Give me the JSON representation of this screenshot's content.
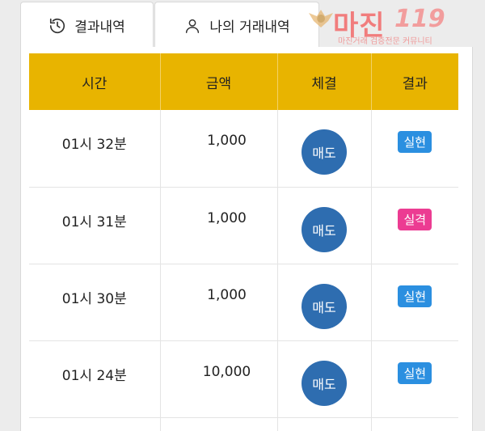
{
  "tabs": [
    {
      "label": "결과내역",
      "icon": "history-icon"
    },
    {
      "label": "나의 거래내역",
      "icon": "user-icon"
    }
  ],
  "watermark": {
    "title": "마진",
    "number": "119",
    "subtitle": "마진거래 검증전문 커뮤니티"
  },
  "table": {
    "headers": [
      "시간",
      "금액",
      "체결",
      "결과"
    ],
    "rows": [
      {
        "time": "01시 32분",
        "amount": "1,000",
        "exec": "매도",
        "result": "실현",
        "result_color": "#2b8fe0"
      },
      {
        "time": "01시 31분",
        "amount": "1,000",
        "exec": "매도",
        "result": "실격",
        "result_color": "#ec3c92"
      },
      {
        "time": "01시 30분",
        "amount": "1,000",
        "exec": "매도",
        "result": "실현",
        "result_color": "#2b8fe0"
      },
      {
        "time": "01시 24분",
        "amount": "10,000",
        "exec": "매도",
        "result": "실현",
        "result_color": "#2b8fe0"
      }
    ]
  },
  "colors": {
    "header_bg": "#e8b400",
    "sell_circle": "#2e6db0"
  }
}
